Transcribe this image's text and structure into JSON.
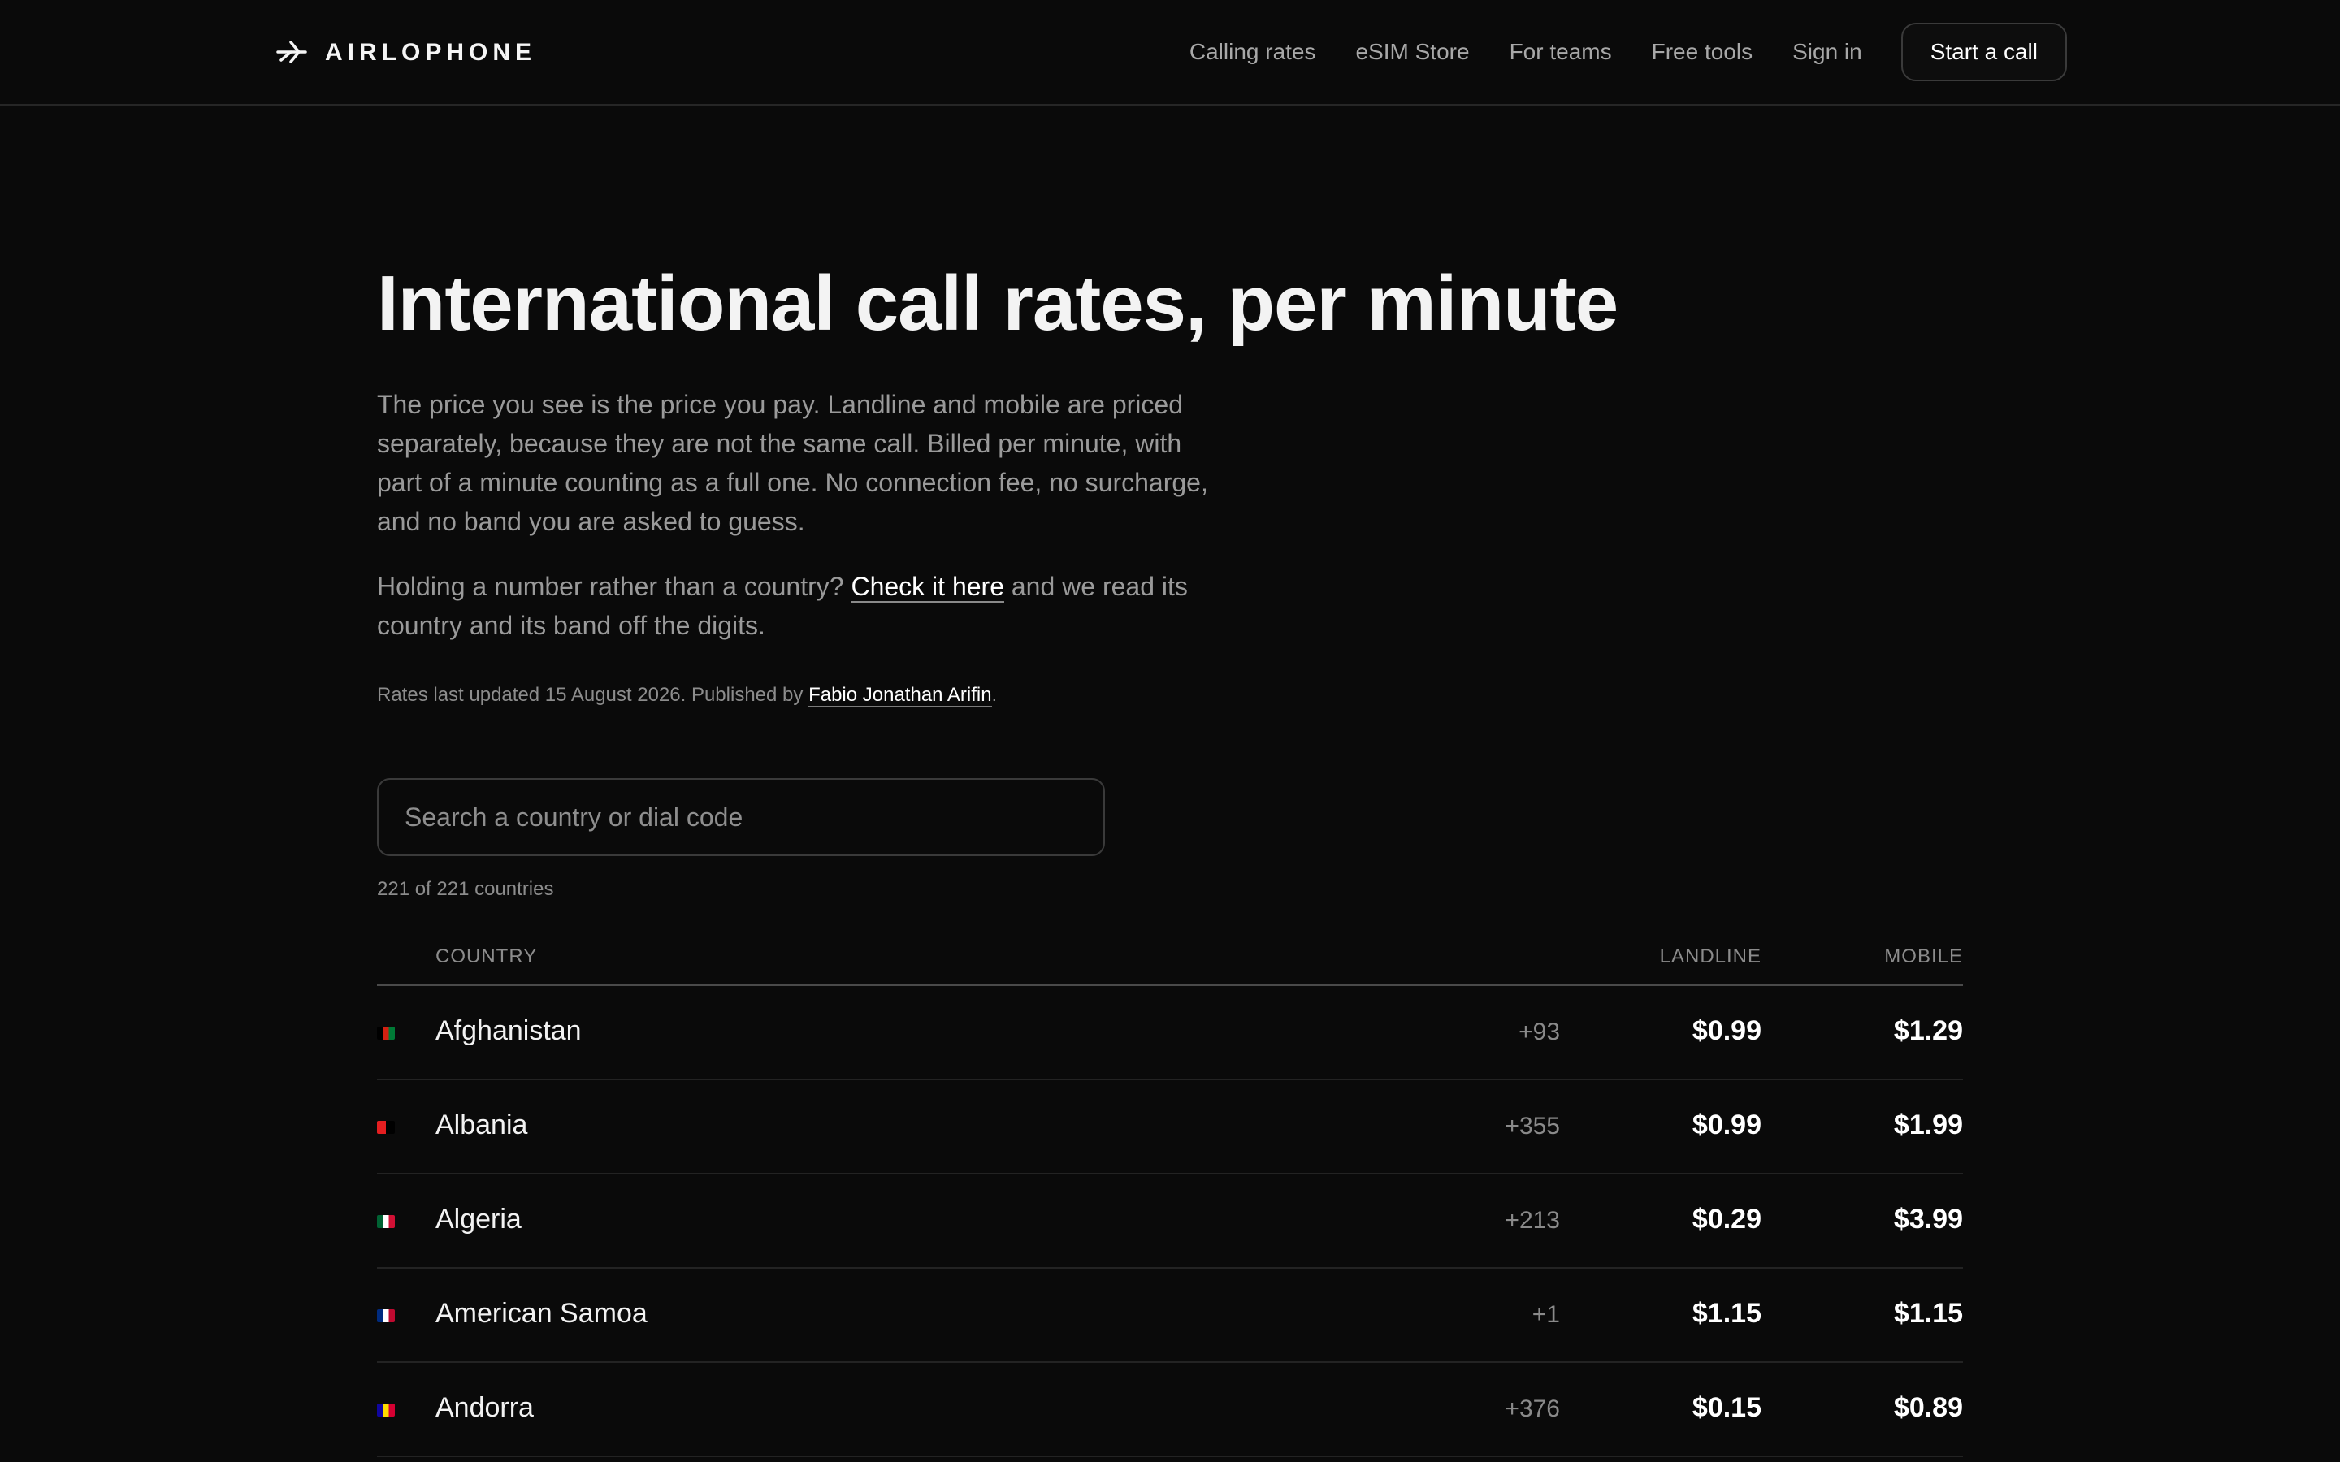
{
  "header": {
    "brand": "AIRLOPHONE",
    "nav": [
      "Calling rates",
      "eSIM Store",
      "For teams",
      "Free tools",
      "Sign in"
    ],
    "cta": "Start a call"
  },
  "hero": {
    "title": "International call rates, per minute",
    "intro": "The price you see is the price you pay. Landline and mobile are priced separately, because they are not the same call. Billed per minute, with part of a minute counting as a full one. No connection fee, no surcharge, and no band you are asked to guess.",
    "lookup_prefix": "Holding a number rather than a country?",
    "lookup_link": "Check it here",
    "lookup_suffix": "and we read its country and its band off the digits.",
    "meta_prefix": "Rates last updated 15 August 2026. Published by",
    "author": "Fabio Jonathan Arifin",
    "meta_suffix": "."
  },
  "search": {
    "placeholder": "Search a country or dial code",
    "value": "",
    "count": "221 of 221 countries"
  },
  "table": {
    "headers": {
      "country": "COUNTRY",
      "landline": "LANDLINE",
      "mobile": "MOBILE"
    },
    "rows": [
      {
        "country": "Afghanistan",
        "dial": "+93",
        "landline": "$0.99",
        "mobile": "$1.29",
        "flag_colors": [
          "#000000",
          "#d32011",
          "#007a36"
        ]
      },
      {
        "country": "Albania",
        "dial": "+355",
        "landline": "$0.99",
        "mobile": "$1.99",
        "flag_colors": [
          "#e41e20",
          "#000000"
        ]
      },
      {
        "country": "Algeria",
        "dial": "+213",
        "landline": "$0.29",
        "mobile": "$3.99",
        "flag_colors": [
          "#006233",
          "#ffffff",
          "#d21034"
        ]
      },
      {
        "country": "American Samoa",
        "dial": "+1",
        "landline": "$1.15",
        "mobile": "$1.15",
        "flag_colors": [
          "#002b7f",
          "#ffffff",
          "#bf0a30"
        ]
      },
      {
        "country": "Andorra",
        "dial": "+376",
        "landline": "$0.15",
        "mobile": "$0.89",
        "flag_colors": [
          "#10069f",
          "#fedd00",
          "#d50032"
        ]
      }
    ]
  }
}
